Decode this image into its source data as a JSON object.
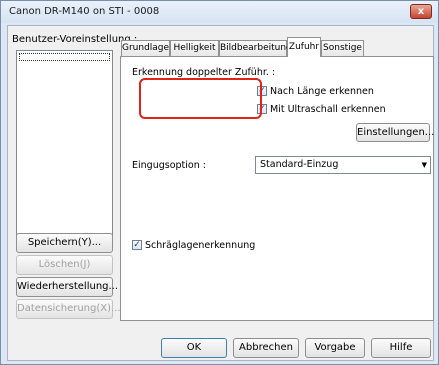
{
  "window": {
    "title": "Canon DR-M140 on STI - 0008",
    "close_glyph": "x"
  },
  "left": {
    "preset_label": "Benutzer-Voreinstellung :",
    "buttons": {
      "save": "Speichern(Y)...",
      "delete": "Löschen(J)",
      "restore": "Wiederherstellung...",
      "backup": "Datensicherung(X)..."
    }
  },
  "tabs": [
    "Grundlage",
    "Helligkeit",
    "Bildbearbeitung",
    "Zufuhr",
    "Sonstige"
  ],
  "active_tab": "Zufuhr",
  "feed": {
    "double_feed_label": "Erkennung doppelter Zuführ. :",
    "length_detect": {
      "label": "Nach Länge erkennen",
      "checked": true
    },
    "ultrasonic_detect": {
      "label": "Mit Ultraschall erkennen",
      "checked": true
    },
    "settings_button": "Einstellungen...",
    "feeding_option_label": "Eingugsoption :",
    "feeding_option_value": "Standard-Einzug",
    "skew_detect": {
      "label": "Schräglagenerkennung",
      "checked": true
    }
  },
  "footer": {
    "ok": "OK",
    "cancel": "Abbrechen",
    "default": "Vorgabe",
    "help": "Hilfe"
  },
  "colors": {
    "highlight": "#e2231a",
    "titlebar": "#dbe7f5"
  }
}
